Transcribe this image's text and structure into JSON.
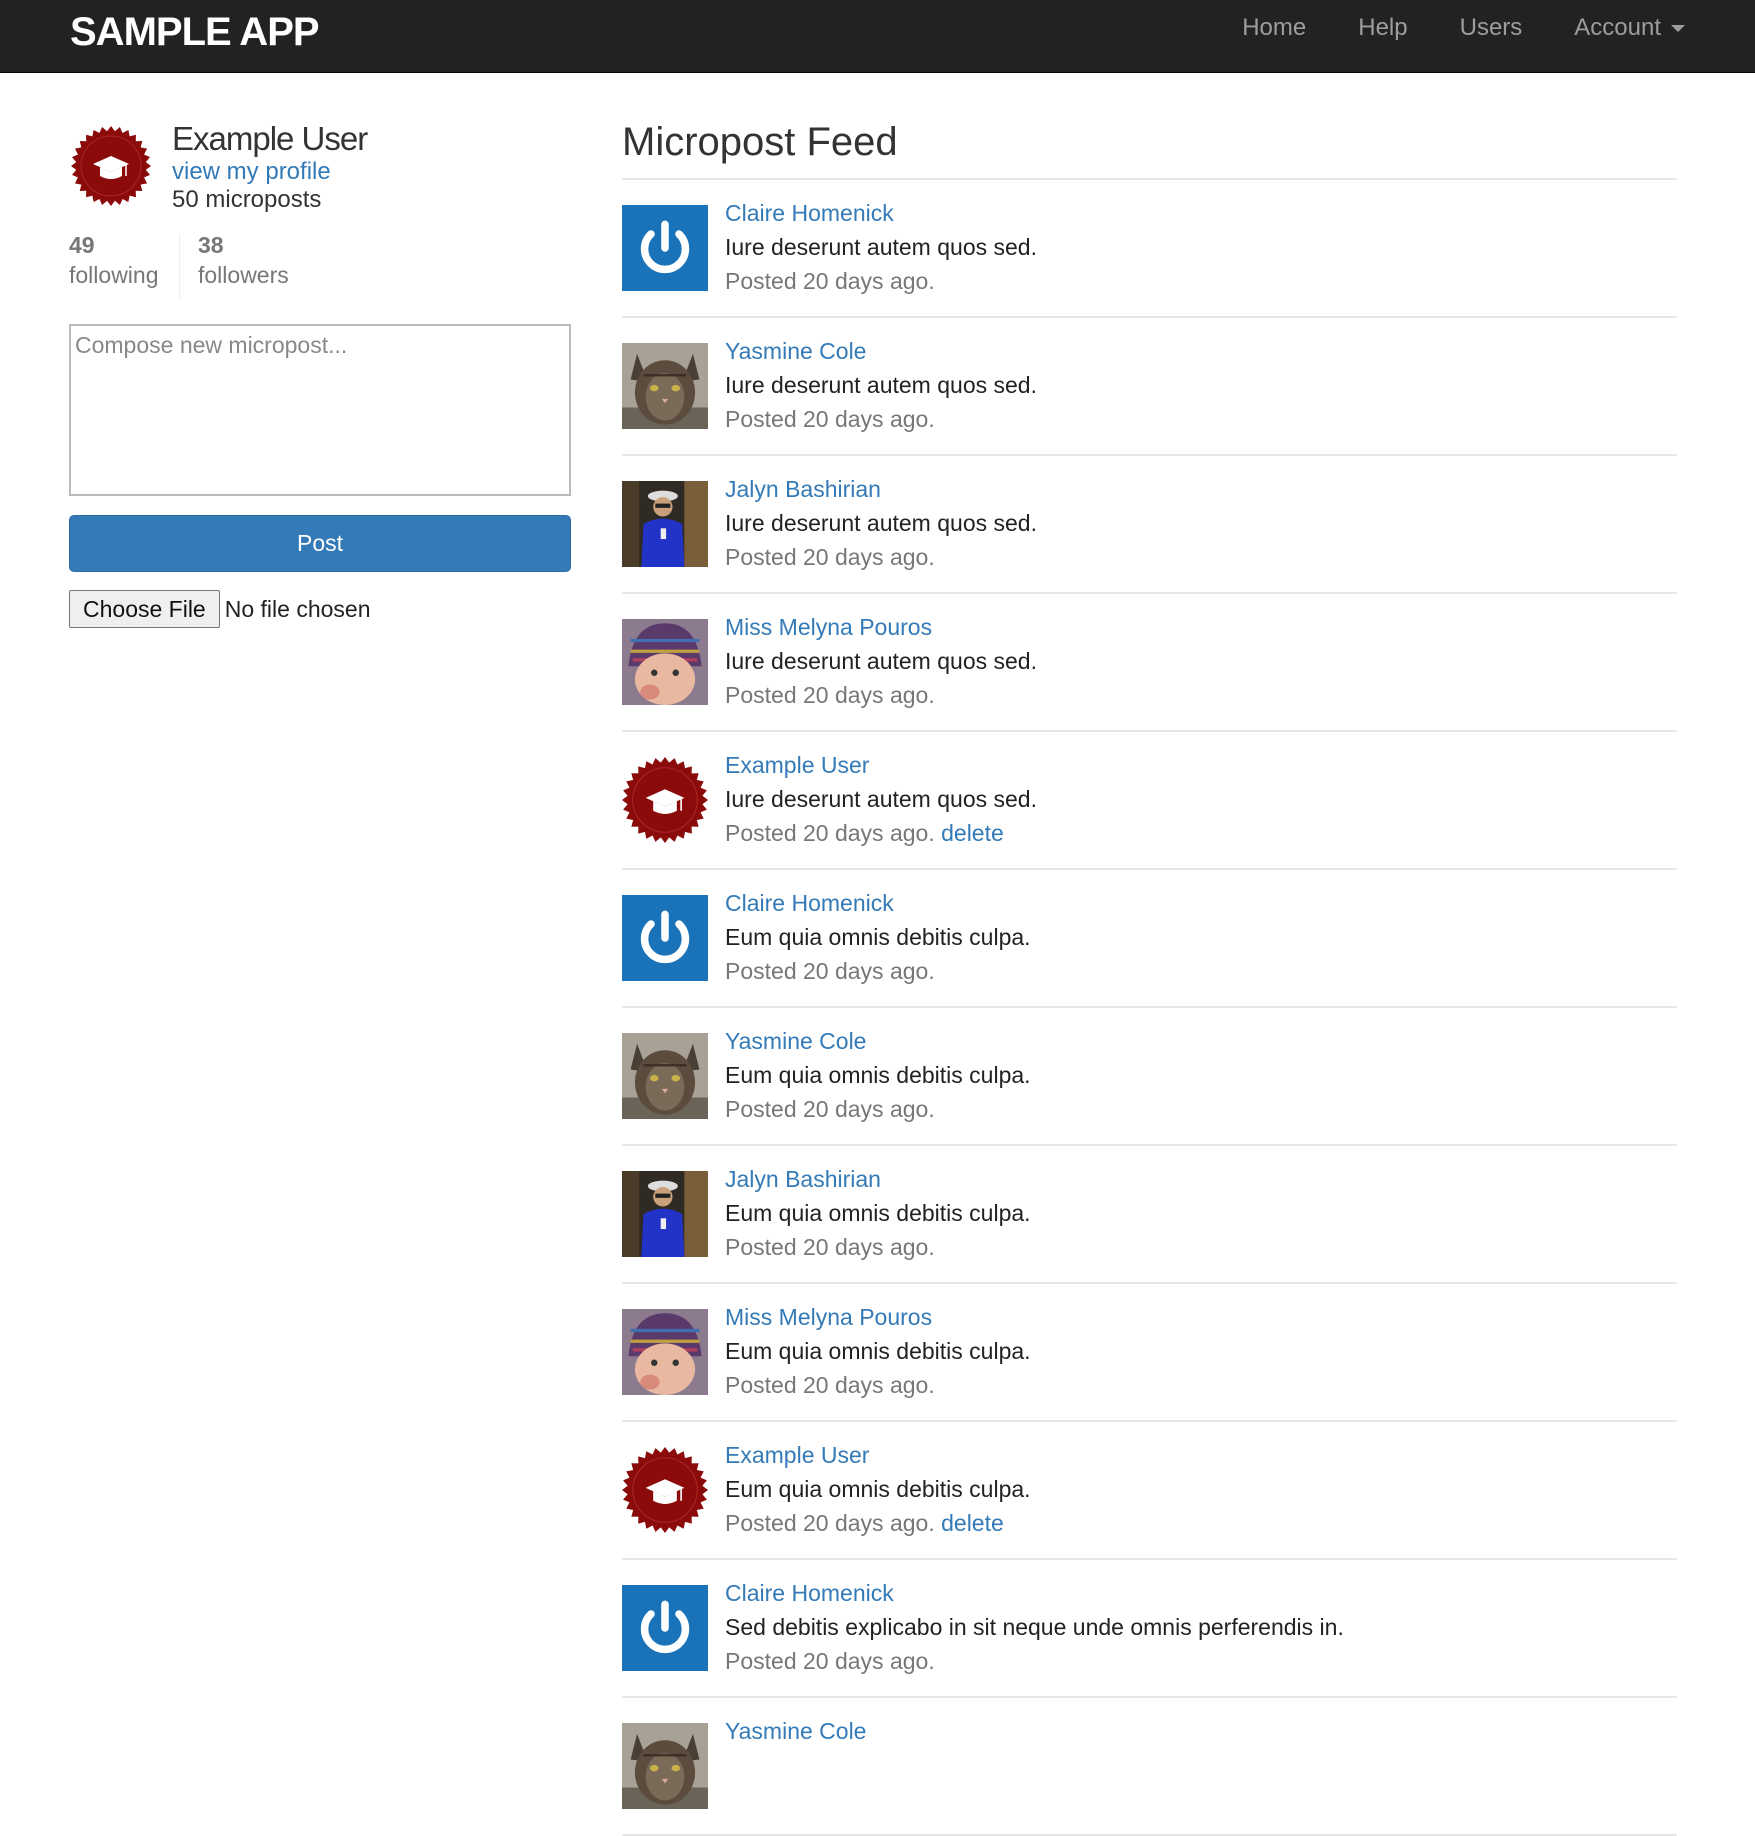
{
  "header": {
    "brand": "SAMPLE APP",
    "nav": {
      "home": "Home",
      "help": "Help",
      "users": "Users",
      "account": "Account"
    }
  },
  "sidebar": {
    "user_name": "Example User",
    "view_profile": "view my profile",
    "micropost_count": "50 microposts",
    "following_count": "49",
    "following_label": "following",
    "followers_count": "38",
    "followers_label": "followers",
    "compose_placeholder": "Compose new micropost...",
    "post_button": "Post",
    "choose_file": "Choose File",
    "file_status": "No file chosen"
  },
  "feed": {
    "title": "Micropost Feed",
    "posts": [
      {
        "user": "Claire Homenick",
        "avatar": "power-avatar",
        "content": "Iure deserunt autem quos sed.",
        "time": "Posted 20 days ago.",
        "delete": ""
      },
      {
        "user": "Yasmine Cole",
        "avatar": "cat-avatar",
        "content": "Iure deserunt autem quos sed.",
        "time": "Posted 20 days ago.",
        "delete": ""
      },
      {
        "user": "Jalyn Bashirian",
        "avatar": "person-avatar",
        "content": "Iure deserunt autem quos sed.",
        "time": "Posted 20 days ago.",
        "delete": ""
      },
      {
        "user": "Miss Melyna Pouros",
        "avatar": "baby-avatar",
        "content": "Iure deserunt autem quos sed.",
        "time": "Posted 20 days ago.",
        "delete": ""
      },
      {
        "user": "Example User",
        "avatar": "seal-avatar",
        "content": "Iure deserunt autem quos sed.",
        "time": "Posted 20 days ago.",
        "delete": "delete"
      },
      {
        "user": "Claire Homenick",
        "avatar": "power-avatar",
        "content": "Eum quia omnis debitis culpa.",
        "time": "Posted 20 days ago.",
        "delete": ""
      },
      {
        "user": "Yasmine Cole",
        "avatar": "cat-avatar",
        "content": "Eum quia omnis debitis culpa.",
        "time": "Posted 20 days ago.",
        "delete": ""
      },
      {
        "user": "Jalyn Bashirian",
        "avatar": "person-avatar",
        "content": "Eum quia omnis debitis culpa.",
        "time": "Posted 20 days ago.",
        "delete": ""
      },
      {
        "user": "Miss Melyna Pouros",
        "avatar": "baby-avatar",
        "content": "Eum quia omnis debitis culpa.",
        "time": "Posted 20 days ago.",
        "delete": ""
      },
      {
        "user": "Example User",
        "avatar": "seal-avatar",
        "content": "Eum quia omnis debitis culpa.",
        "time": "Posted 20 days ago.",
        "delete": "delete"
      },
      {
        "user": "Claire Homenick",
        "avatar": "power-avatar",
        "content": "Sed debitis explicabo in sit neque unde omnis perferendis in.",
        "time": "Posted 20 days ago.",
        "delete": ""
      },
      {
        "user": "Yasmine Cole",
        "avatar": "cat-avatar",
        "content": "",
        "time": "",
        "delete": ""
      }
    ]
  },
  "colors": {
    "navbar": "#222222",
    "link": "#337ab7",
    "button": "#337ab7",
    "seal": "#8b0a0a",
    "power_bg": "#1a73b8"
  }
}
